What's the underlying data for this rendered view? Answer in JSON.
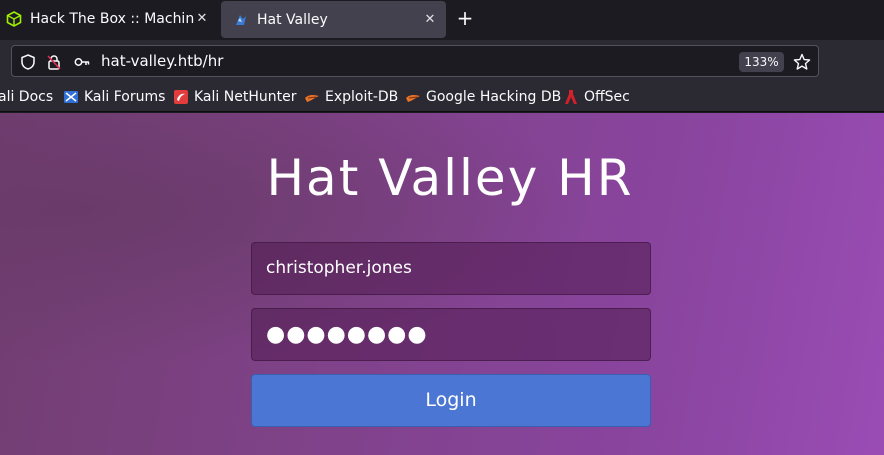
{
  "browser": {
    "tabs": [
      {
        "title": "Hack The Box :: Machines",
        "close": "✕",
        "favicon": "htb-cube-icon",
        "favicon_color": "#9fef00"
      },
      {
        "title": "Hat Valley",
        "close": "✕",
        "favicon": "hat-valley-icon"
      }
    ],
    "new_tab": "+",
    "url": "hat-valley.htb/hr",
    "zoom": "133%"
  },
  "bookmarks": [
    {
      "label": "ali Docs"
    },
    {
      "label": "Kali Forums"
    },
    {
      "label": "Kali NetHunter"
    },
    {
      "label": "Exploit-DB"
    },
    {
      "label": "Google Hacking DB"
    },
    {
      "label": "OffSec"
    }
  ],
  "page": {
    "title": "Hat Valley HR",
    "username": "christopher.jones",
    "password_mask": "●●●●●●●●",
    "login_label": "Login"
  },
  "colors": {
    "login_button": "#4b76d3",
    "active_tab": "#42414d"
  }
}
